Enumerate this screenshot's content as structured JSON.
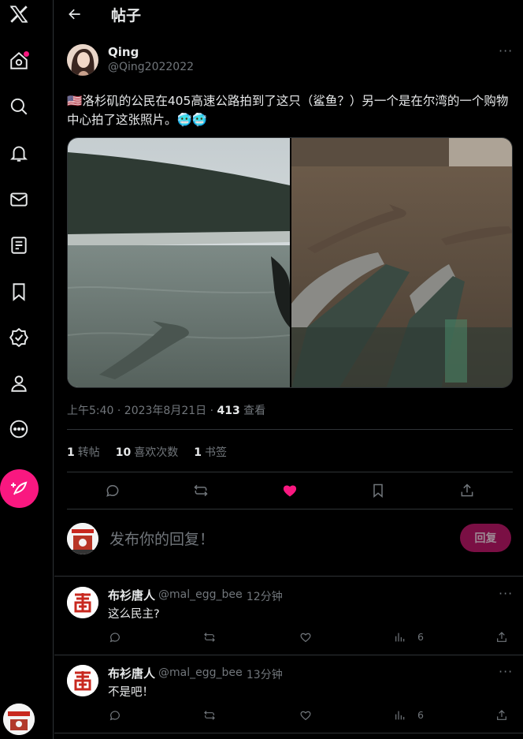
{
  "header": {
    "title": "帖子"
  },
  "post": {
    "author_name": "Qing",
    "author_handle": "@Qing2022022",
    "flag": "🇺🇸",
    "text": "洛杉矶的公民在405高速公路拍到了这只（鲨鱼？）另一个是在尔湾的一个购物中心拍了这张照片。",
    "emoji": "🥶🥶",
    "time": "上午5:40 · 2023年8月21日 · ",
    "views": "413",
    "views_label": " 查看",
    "reposts": "1",
    "reposts_label": "转帖",
    "likes": "10",
    "likes_label": "喜欢次数",
    "bookmarks": "1",
    "bookmarks_label": "书签"
  },
  "composer": {
    "placeholder": "发布你的回复！",
    "button": "回复"
  },
  "comments": [
    {
      "name": "布衫唐人",
      "handle": "@mal_egg_bee",
      "time": "· 12分钟",
      "text": "这么民主?",
      "views": "6"
    },
    {
      "name": "布衫唐人",
      "handle": "@mal_egg_bee",
      "time": "· 13分钟",
      "text": "不是吧！",
      "views": "6"
    }
  ],
  "colors": {
    "accent": "#f91880",
    "background": "#000000",
    "muted": "#71767b"
  },
  "icons": [
    "x-logo-icon",
    "home-icon",
    "search-icon",
    "bell-icon",
    "mail-icon",
    "lists-icon",
    "bookmark-icon",
    "verified-icon",
    "profile-icon",
    "more-icon",
    "compose-icon"
  ]
}
